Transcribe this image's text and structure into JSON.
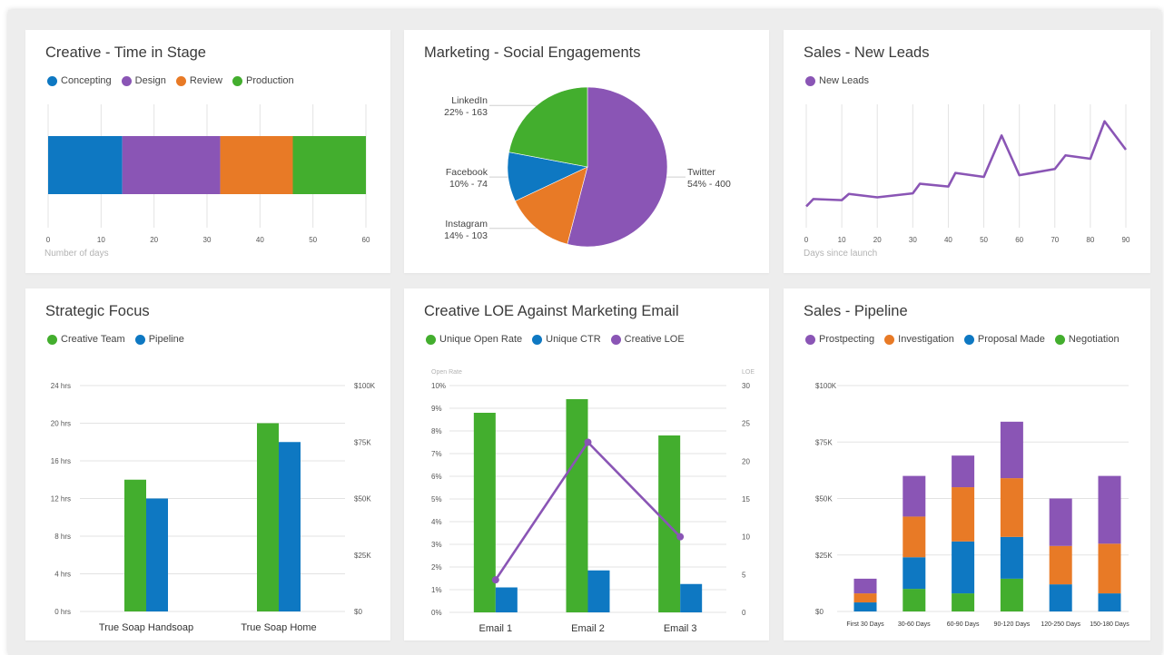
{
  "colors": {
    "blue": "#0e78c2",
    "purple": "#8a55b5",
    "orange": "#e87a26",
    "green": "#43ae2e",
    "grid": "#e3e3e3"
  },
  "cards": [
    {
      "title": "Creative - Time in Stage",
      "legend": [
        {
          "label": "Concepting",
          "color": "#0e78c2"
        },
        {
          "label": "Design",
          "color": "#8a55b5"
        },
        {
          "label": "Review",
          "color": "#e87a26"
        },
        {
          "label": "Production",
          "color": "#43ae2e"
        }
      ]
    },
    {
      "title": "Marketing - Social Engagements",
      "legend": []
    },
    {
      "title": "Sales - New Leads",
      "legend": [
        {
          "label": "New Leads",
          "color": "#8a55b5"
        }
      ]
    },
    {
      "title": "Strategic Focus",
      "legend": [
        {
          "label": "Creative Team",
          "color": "#43ae2e"
        },
        {
          "label": "Pipeline",
          "color": "#0e78c2"
        }
      ]
    },
    {
      "title": "Creative LOE Against Marketing Email",
      "legend": [
        {
          "label": "Unique Open Rate",
          "color": "#43ae2e"
        },
        {
          "label": "Unique CTR",
          "color": "#0e78c2"
        },
        {
          "label": "Creative LOE",
          "color": "#8a55b5"
        }
      ]
    },
    {
      "title": "Sales - Pipeline",
      "legend": [
        {
          "label": "Prostpecting",
          "color": "#8a55b5"
        },
        {
          "label": "Investigation",
          "color": "#e87a26"
        },
        {
          "label": "Proposal Made",
          "color": "#0e78c2"
        },
        {
          "label": "Negotiation",
          "color": "#43ae2e"
        }
      ]
    }
  ],
  "chart_data": [
    {
      "type": "bar",
      "orientation": "horizontal-stacked",
      "title": "Creative - Time in Stage",
      "xlabel": "Number of days",
      "xlim": [
        0,
        60
      ],
      "xticks": [
        0,
        10,
        20,
        30,
        40,
        50,
        60
      ],
      "series": [
        {
          "name": "Concepting",
          "values": [
            14
          ]
        },
        {
          "name": "Design",
          "values": [
            18.5
          ]
        },
        {
          "name": "Review",
          "values": [
            13.7
          ]
        },
        {
          "name": "Production",
          "values": [
            13.8
          ]
        }
      ],
      "grid": true,
      "legend": "top-left"
    },
    {
      "type": "pie",
      "title": "Marketing - Social Engagements",
      "slices": [
        {
          "name": "Twitter",
          "label": "Twitter",
          "value_text": "54% - 400",
          "value": 400,
          "color": "#8a55b5"
        },
        {
          "name": "Instagram",
          "label": "Instagram",
          "value_text": "14% - 103",
          "value": 103,
          "color": "#e87a26"
        },
        {
          "name": "Facebook",
          "label": "Facebook",
          "value_text": "10% - 74",
          "value": 74,
          "color": "#0e78c2"
        },
        {
          "name": "LinkedIn",
          "label": "LinkedIn",
          "value_text": "22% - 163",
          "value": 163,
          "color": "#43ae2e"
        }
      ]
    },
    {
      "type": "line",
      "title": "Sales - New Leads",
      "xlabel": "Days since launch",
      "xlim": [
        0,
        90
      ],
      "xticks": [
        0,
        10,
        20,
        30,
        40,
        50,
        60,
        70,
        80,
        90
      ],
      "series": [
        {
          "name": "New Leads",
          "x": [
            0,
            2,
            10,
            12,
            20,
            30,
            32,
            40,
            42,
            50,
            55,
            60,
            70,
            73,
            80,
            84,
            90
          ],
          "y": [
            20,
            33,
            31,
            42,
            36,
            43,
            60,
            55,
            79,
            72,
            145,
            75,
            86,
            110,
            104,
            170,
            120
          ]
        }
      ],
      "ylim": [
        0,
        200
      ],
      "grid": true,
      "legend": "top-left"
    },
    {
      "type": "bar",
      "title": "Strategic Focus",
      "categories": [
        "True Soap Handsoap",
        "True Soap Home"
      ],
      "yticks_left": [
        "0 hrs",
        "4 hrs",
        "8 hrs",
        "12 hrs",
        "16 hrs",
        "20 hrs",
        "24 hrs"
      ],
      "yticks_right": [
        "$0",
        "$25K",
        "$50K",
        "$75K",
        "$100K"
      ],
      "ylim_left": [
        0,
        24
      ],
      "ylim_right": [
        0,
        100000
      ],
      "series": [
        {
          "name": "Creative Team",
          "axis": "left",
          "values": [
            14,
            20
          ]
        },
        {
          "name": "Pipeline",
          "axis": "right",
          "values": [
            50000,
            75000
          ]
        }
      ],
      "grid": true,
      "legend": "top-left"
    },
    {
      "type": "bar",
      "title": "Creative LOE Against Marketing Email",
      "categories": [
        "Email 1",
        "Email 2",
        "Email 3"
      ],
      "ylabel_left": "Open Rate",
      "ylabel_right": "LOE",
      "yticks_left": [
        "0%",
        "1%",
        "2%",
        "3%",
        "4%",
        "5%",
        "6%",
        "7%",
        "8%",
        "9%",
        "10%"
      ],
      "yticks_right": [
        "0",
        "5",
        "10",
        "15",
        "20",
        "25",
        "30"
      ],
      "ylim_left": [
        0,
        10
      ],
      "ylim_right": [
        0,
        30
      ],
      "series": [
        {
          "name": "Unique Open Rate",
          "type": "bar",
          "axis": "left",
          "values": [
            8.8,
            9.4,
            7.8
          ]
        },
        {
          "name": "Unique CTR",
          "type": "bar",
          "axis": "left",
          "values": [
            1.1,
            1.85,
            1.25
          ]
        },
        {
          "name": "Creative LOE",
          "type": "line",
          "axis": "right",
          "values": [
            4.3,
            22.5,
            10
          ]
        }
      ],
      "grid": true,
      "legend": "top-left"
    },
    {
      "type": "bar",
      "orientation": "vertical-stacked",
      "title": "Sales - Pipeline",
      "categories": [
        "First 30 Days",
        "30-60 Days",
        "60-90 Days",
        "90-120 Days",
        "120-250 Days",
        "150-180 Days"
      ],
      "yticks": [
        "$0",
        "$25K",
        "$50K",
        "$75K",
        "$100K"
      ],
      "ylim": [
        0,
        100000
      ],
      "series": [
        {
          "name": "Negotiation",
          "values": [
            0,
            10000,
            8000,
            14500,
            0,
            0
          ]
        },
        {
          "name": "Proposal Made",
          "values": [
            4000,
            14000,
            23000,
            18500,
            12000,
            8000
          ]
        },
        {
          "name": "Investigation",
          "values": [
            4000,
            18000,
            24000,
            26000,
            17000,
            22000
          ]
        },
        {
          "name": "Prostpecting",
          "values": [
            6500,
            18000,
            14000,
            25000,
            21000,
            30000
          ]
        }
      ],
      "grid": true,
      "legend": "top-left"
    }
  ]
}
